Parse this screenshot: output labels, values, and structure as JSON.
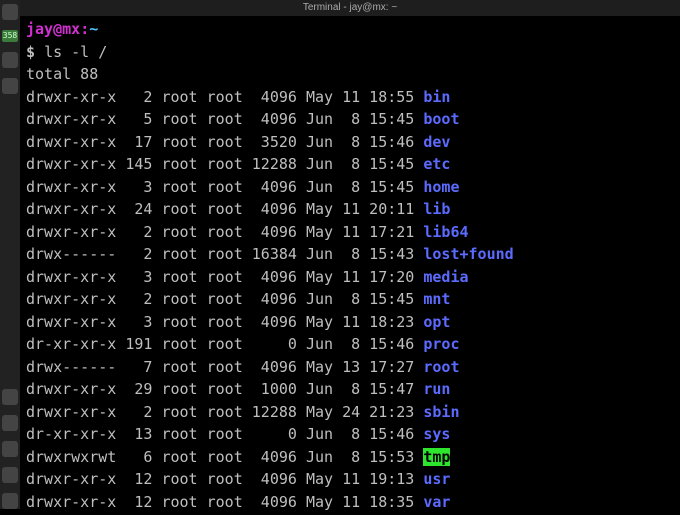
{
  "titlebar": "Terminal - jay@mx: ~",
  "prompt": {
    "user": "jay",
    "at": "@",
    "host": "mx",
    "colon": ":",
    "path": "~",
    "symbol": "$",
    "command": "ls -l /"
  },
  "total_line": "total 88",
  "rows": [
    {
      "perm": "drwxr-xr-x",
      "links": "2",
      "owner": "root",
      "group": "root",
      "size": "4096",
      "month": "May",
      "day": "11",
      "time": "18:55",
      "name": "bin",
      "style": "dir-blue"
    },
    {
      "perm": "drwxr-xr-x",
      "links": "5",
      "owner": "root",
      "group": "root",
      "size": "4096",
      "month": "Jun",
      "day": "8",
      "time": "15:45",
      "name": "boot",
      "style": "dir-blue"
    },
    {
      "perm": "drwxr-xr-x",
      "links": "17",
      "owner": "root",
      "group": "root",
      "size": "3520",
      "month": "Jun",
      "day": "8",
      "time": "15:46",
      "name": "dev",
      "style": "dir-blue"
    },
    {
      "perm": "drwxr-xr-x",
      "links": "145",
      "owner": "root",
      "group": "root",
      "size": "12288",
      "month": "Jun",
      "day": "8",
      "time": "15:45",
      "name": "etc",
      "style": "dir-blue"
    },
    {
      "perm": "drwxr-xr-x",
      "links": "3",
      "owner": "root",
      "group": "root",
      "size": "4096",
      "month": "Jun",
      "day": "8",
      "time": "15:45",
      "name": "home",
      "style": "dir-blue"
    },
    {
      "perm": "drwxr-xr-x",
      "links": "24",
      "owner": "root",
      "group": "root",
      "size": "4096",
      "month": "May",
      "day": "11",
      "time": "20:11",
      "name": "lib",
      "style": "dir-blue"
    },
    {
      "perm": "drwxr-xr-x",
      "links": "2",
      "owner": "root",
      "group": "root",
      "size": "4096",
      "month": "May",
      "day": "11",
      "time": "17:21",
      "name": "lib64",
      "style": "dir-blue"
    },
    {
      "perm": "drwx------",
      "links": "2",
      "owner": "root",
      "group": "root",
      "size": "16384",
      "month": "Jun",
      "day": "8",
      "time": "15:43",
      "name": "lost+found",
      "style": "dir-blue"
    },
    {
      "perm": "drwxr-xr-x",
      "links": "3",
      "owner": "root",
      "group": "root",
      "size": "4096",
      "month": "May",
      "day": "11",
      "time": "17:20",
      "name": "media",
      "style": "dir-blue"
    },
    {
      "perm": "drwxr-xr-x",
      "links": "2",
      "owner": "root",
      "group": "root",
      "size": "4096",
      "month": "Jun",
      "day": "8",
      "time": "15:45",
      "name": "mnt",
      "style": "dir-blue"
    },
    {
      "perm": "drwxr-xr-x",
      "links": "3",
      "owner": "root",
      "group": "root",
      "size": "4096",
      "month": "May",
      "day": "11",
      "time": "18:23",
      "name": "opt",
      "style": "dir-blue"
    },
    {
      "perm": "dr-xr-xr-x",
      "links": "191",
      "owner": "root",
      "group": "root",
      "size": "0",
      "month": "Jun",
      "day": "8",
      "time": "15:46",
      "name": "proc",
      "style": "dir-blue"
    },
    {
      "perm": "drwx------",
      "links": "7",
      "owner": "root",
      "group": "root",
      "size": "4096",
      "month": "May",
      "day": "13",
      "time": "17:27",
      "name": "root",
      "style": "dir-blue"
    },
    {
      "perm": "drwxr-xr-x",
      "links": "29",
      "owner": "root",
      "group": "root",
      "size": "1000",
      "month": "Jun",
      "day": "8",
      "time": "15:47",
      "name": "run",
      "style": "dir-blue"
    },
    {
      "perm": "drwxr-xr-x",
      "links": "2",
      "owner": "root",
      "group": "root",
      "size": "12288",
      "month": "May",
      "day": "24",
      "time": "21:23",
      "name": "sbin",
      "style": "dir-blue"
    },
    {
      "perm": "dr-xr-xr-x",
      "links": "13",
      "owner": "root",
      "group": "root",
      "size": "0",
      "month": "Jun",
      "day": "8",
      "time": "15:46",
      "name": "sys",
      "style": "dir-blue"
    },
    {
      "perm": "drwxrwxrwt",
      "links": "6",
      "owner": "root",
      "group": "root",
      "size": "4096",
      "month": "Jun",
      "day": "8",
      "time": "15:53",
      "name": "tmp",
      "style": "dir-green-bg"
    },
    {
      "perm": "drwxr-xr-x",
      "links": "12",
      "owner": "root",
      "group": "root",
      "size": "4096",
      "month": "May",
      "day": "11",
      "time": "19:13",
      "name": "usr",
      "style": "dir-blue"
    },
    {
      "perm": "drwxr-xr-x",
      "links": "12",
      "owner": "root",
      "group": "root",
      "size": "4096",
      "month": "May",
      "day": "11",
      "time": "18:35",
      "name": "var",
      "style": "dir-blue"
    }
  ],
  "panel": {
    "badge": "358"
  }
}
